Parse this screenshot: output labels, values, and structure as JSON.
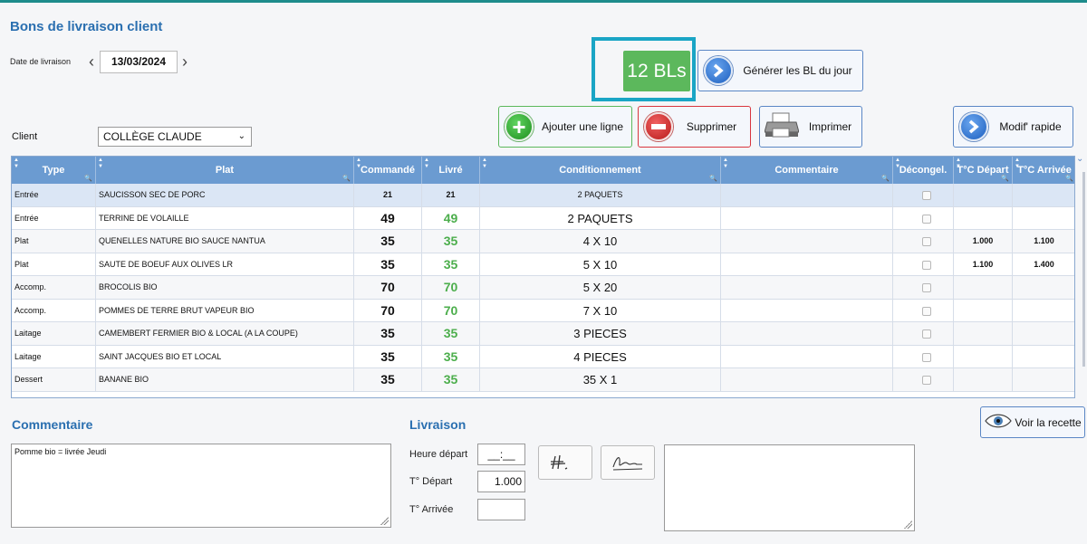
{
  "header": {
    "title": "Bons de livraison client"
  },
  "date": {
    "label": "Date de livraison",
    "value": "13/03/2024"
  },
  "bl_count": "12 BLs",
  "buttons": {
    "generate": "Générer les BL du jour",
    "add_line": "Ajouter une ligne",
    "delete": "Supprimer",
    "print": "Imprimer",
    "quick_edit": "Modif' rapide",
    "view_recipe": "Voir la recette"
  },
  "client": {
    "label": "Client",
    "selected": "COLLÈGE CLAUDE"
  },
  "table": {
    "columns": [
      "Type",
      "Plat",
      "Commandé",
      "Livré",
      "Conditionnement",
      "Commentaire",
      "Décongel.",
      "T°C Départ",
      "T°C Arrivée"
    ],
    "rows": [
      {
        "type": "Entrée",
        "plat": "SAUCISSON SEC DE PORC",
        "commande": "21",
        "livre": "21",
        "cond": "2 PAQUETS",
        "comment": "",
        "dep": "",
        "arr": ""
      },
      {
        "type": "Entrée",
        "plat": "TERRINE DE VOLAILLE",
        "commande": "49",
        "livre": "49",
        "cond": "2 PAQUETS",
        "comment": "",
        "dep": "",
        "arr": ""
      },
      {
        "type": "Plat",
        "plat": "QUENELLES NATURE BIO SAUCE NANTUA",
        "commande": "35",
        "livre": "35",
        "cond": "4 X 10",
        "comment": "",
        "dep": "1.000",
        "arr": "1.100"
      },
      {
        "type": "Plat",
        "plat": "SAUTE DE BOEUF AUX OLIVES LR",
        "commande": "35",
        "livre": "35",
        "cond": "5 X 10",
        "comment": "",
        "dep": "1.100",
        "arr": "1.400"
      },
      {
        "type": "Accomp.",
        "plat": "BROCOLIS BIO",
        "commande": "70",
        "livre": "70",
        "cond": "5 X 20",
        "comment": "",
        "dep": "",
        "arr": ""
      },
      {
        "type": "Accomp.",
        "plat": "POMMES DE TERRE BRUT VAPEUR BIO",
        "commande": "70",
        "livre": "70",
        "cond": "7 X 10",
        "comment": "",
        "dep": "",
        "arr": ""
      },
      {
        "type": "Laitage",
        "plat": "CAMEMBERT FERMIER BIO & LOCAL (A LA COUPE)",
        "commande": "35",
        "livre": "35",
        "cond": "3 PIECES",
        "comment": "",
        "dep": "",
        "arr": ""
      },
      {
        "type": "Laitage",
        "plat": "SAINT JACQUES BIO ET LOCAL",
        "commande": "35",
        "livre": "35",
        "cond": "4 PIECES",
        "comment": "",
        "dep": "",
        "arr": ""
      },
      {
        "type": "Dessert",
        "plat": "BANANE BIO",
        "commande": "35",
        "livre": "35",
        "cond": "35 X 1",
        "comment": "",
        "dep": "",
        "arr": ""
      }
    ]
  },
  "comment": {
    "title": "Commentaire",
    "text": "Pomme bio = livrée Jeudi"
  },
  "delivery": {
    "title": "Livraison",
    "heure_label": "Heure départ",
    "heure_value": "__:__",
    "t_depart_label": "T° Départ",
    "t_depart_value": "1.000",
    "t_arrivee_label": "T° Arrivée",
    "t_arrivee_value": ""
  },
  "colors": {
    "accent": "#2a6fb0",
    "header_bg": "#6b9bd1",
    "green": "#5cb85c",
    "highlight": "#1aa5c5"
  }
}
